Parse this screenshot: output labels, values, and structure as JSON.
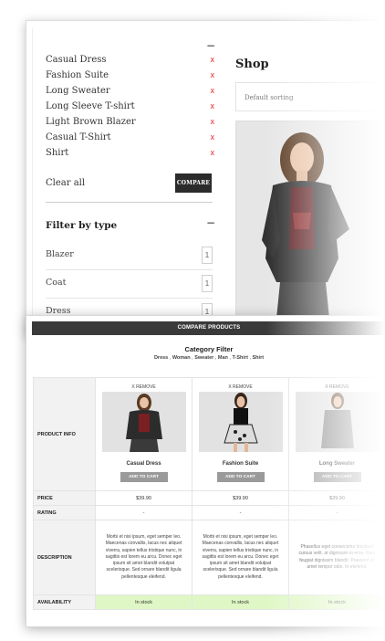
{
  "shop": {
    "selected_filters": [
      {
        "label": "Casual Dress",
        "remove": "x"
      },
      {
        "label": "Fashion Suite",
        "remove": "x"
      },
      {
        "label": "Long Sweater",
        "remove": "x"
      },
      {
        "label": "Long Sleeve T-shirt",
        "remove": "x"
      },
      {
        "label": "Light Brown Blazer",
        "remove": "x"
      },
      {
        "label": "Casual T-Shirt",
        "remove": "x"
      },
      {
        "label": "Shirt",
        "remove": "x"
      }
    ],
    "collapse_icon": "−",
    "clear_all": "Clear all",
    "compare_button": "COMPARE",
    "filter_by_type": {
      "title": "Filter by type",
      "collapse_icon": "−",
      "items": [
        {
          "label": "Blazer",
          "count": "1"
        },
        {
          "label": "Coat",
          "count": "1"
        },
        {
          "label": "Dress",
          "count": "1"
        }
      ]
    },
    "title": "Shop",
    "sort": "Default sorting"
  },
  "compare": {
    "header": "COMPARE PRODUCTS",
    "category_filter_title": "Category Filter",
    "categories": [
      "Dress",
      "Woman",
      "Sweater",
      "Man",
      "T-Shirt",
      "Shirt"
    ],
    "row_labels": {
      "info": "PRODUCT INFO",
      "price": "PRICE",
      "rating": "RATING",
      "description": "DESCRIPTION",
      "availability": "AVAILABILITY"
    },
    "products": [
      {
        "remove": "X REMOVE",
        "name": "Casual Dress",
        "add_to_cart": "ADD TO CART",
        "price": "$39.90",
        "rating": "-",
        "description": "Morbi et nisi ipsum, eget semper leo. Maecenas convallis, lacus nec aliquet viverra, sapien tellus tristique nunc, in sagittis est lorem eu arcu. Donec eget ipsum sit amet blandit volutpat scelerisque. Sed ornare blandit ligula pellentesque eleifend.",
        "availability": "In stock"
      },
      {
        "remove": "X REMOVE",
        "name": "Fashion Suite",
        "add_to_cart": "ADD TO CART",
        "price": "$39.90",
        "rating": "-",
        "description": "Morbi et nisi ipsum, eget semper leo. Maecenas convallis, lacus nec aliquet viverra, sapien tellus tristique nunc, in sagittis est lorem eu arcu. Donec eget ipsum sit amet blandit volutpat scelerisque. Sed ornare blandit ligula pellentesque eleifend.",
        "availability": "In stock"
      },
      {
        "remove": "X REMOVE",
        "name": "Long Sweater",
        "add_to_cart": "ADD TO CART",
        "price": "$39.90",
        "rating": "-",
        "description": "Phasellus eget consectetur tincidunt cursus velit, at dignissim in eros. Nam feugiat dignissim blandit. Praesent sit amet tempor odio. In eleifend.",
        "availability": "In stock"
      }
    ]
  },
  "colors": {
    "remove_x": "#e0262b",
    "dark_button": "#2b2b2b",
    "header_bar": "#3a3a3a",
    "in_stock_bg": "#dff7c5",
    "in_stock_text": "#2a7a14"
  }
}
